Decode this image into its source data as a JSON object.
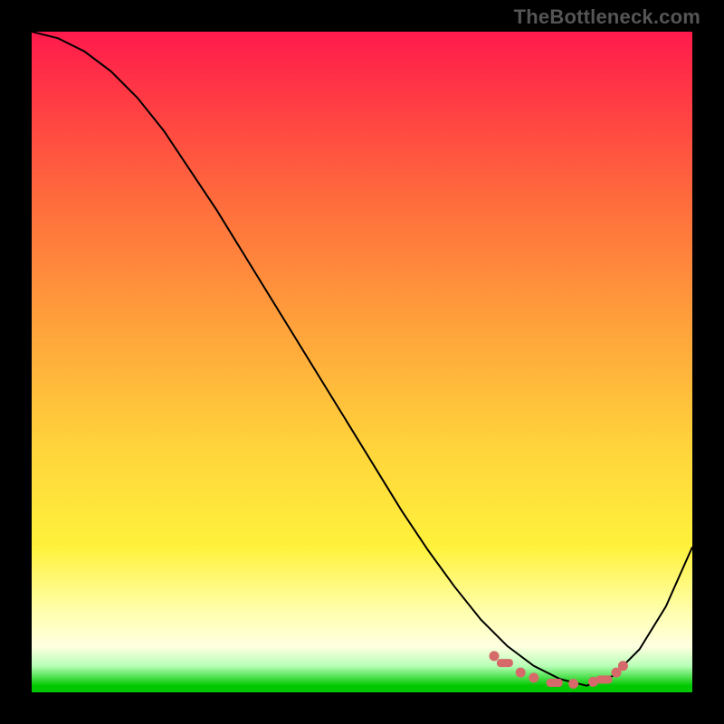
{
  "watermark": "TheBottleneck.com",
  "chart_data": {
    "type": "line",
    "title": "",
    "xlabel": "",
    "ylabel": "",
    "xlim": [
      0,
      100
    ],
    "ylim": [
      0,
      100
    ],
    "grid": false,
    "legend": false,
    "series": [
      {
        "name": "bottleneck-curve",
        "x": [
          0,
          4,
          8,
          12,
          16,
          20,
          24,
          28,
          32,
          36,
          40,
          44,
          48,
          52,
          56,
          60,
          64,
          68,
          72,
          76,
          80,
          84,
          88,
          92,
          96,
          100
        ],
        "y": [
          100,
          99,
          97,
          94,
          90,
          85,
          79,
          73,
          66.5,
          60,
          53.5,
          47,
          40.5,
          34,
          27.5,
          21.5,
          16,
          11,
          7,
          4,
          2,
          1,
          2.5,
          6.5,
          13,
          22
        ],
        "color": "#000000"
      }
    ],
    "markers": {
      "name": "valley-dots",
      "color": "#d66a6a",
      "points": [
        {
          "x": 70,
          "y": 5.5
        },
        {
          "x": 71.5,
          "y": 4.5
        },
        {
          "x": 74,
          "y": 3
        },
        {
          "x": 76,
          "y": 2.2
        },
        {
          "x": 79,
          "y": 1.5
        },
        {
          "x": 82,
          "y": 1.3
        },
        {
          "x": 85,
          "y": 1.6
        },
        {
          "x": 86.5,
          "y": 2
        },
        {
          "x": 88.5,
          "y": 3
        },
        {
          "x": 89.5,
          "y": 4
        }
      ]
    }
  }
}
